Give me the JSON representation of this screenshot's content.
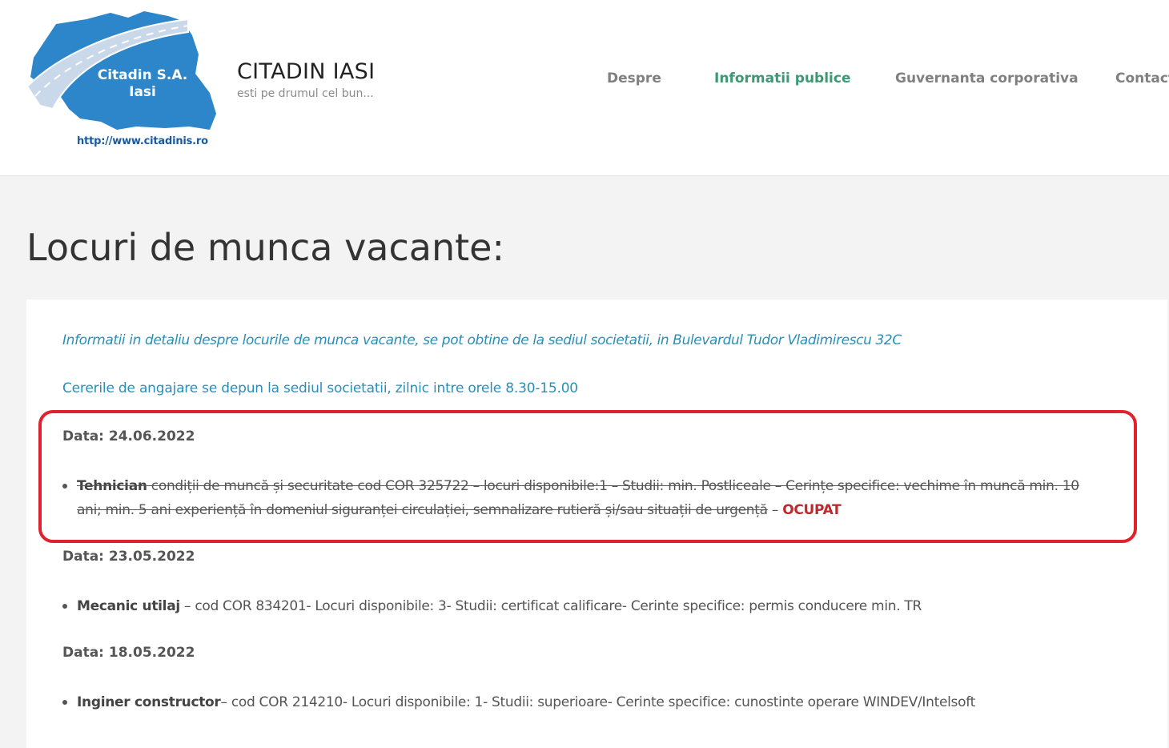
{
  "header": {
    "logo": {
      "name": "Citadin S.A.",
      "city": "Iasi",
      "url": "http://www.citadinis.ro",
      "map_color": "#2d86c9",
      "road_color": "#c9d9ea"
    },
    "site_title": "CITADIN IASI",
    "tagline": "esti pe drumul cel bun...",
    "nav": [
      {
        "label": "Despre",
        "active": false
      },
      {
        "label": "Informatii publice",
        "active": true
      },
      {
        "label": "Guvernanta corporativa",
        "active": false
      },
      {
        "label": "Contact",
        "active": false
      }
    ],
    "nav_active_color": "#3a9a72"
  },
  "page": {
    "title": "Locuri de munca vacante:"
  },
  "content": {
    "intro": "Informatii in detaliu despre locurile de munca vacante, se pot obtine de la sediul societatii, in Bulevardul Tudor Vladimirescu 32C",
    "hours": "Cererile de angajare se depun la sediul societatii, zilnic intre orele 8.30-15.00",
    "sections": [
      {
        "date": "Data: 24.06.2022",
        "jobs": [
          {
            "title": "Tehnician",
            "line1": " condiții de muncă și securitate cod COR 325722 – locuri disponibile:1 – Studii: min. Postliceale – Cerințe specifice: vechime în muncă min. 10",
            "line2": "ani; min. 5 ani experiență în domeniul siguranței circulației, semnalizare rutieră și/sau situații de urgență",
            "separator": " – ",
            "status": "OCUPAT"
          }
        ]
      },
      {
        "date": "Data: 23.05.2022",
        "jobs": [
          {
            "title": "Mecanic utilaj",
            "description": " – cod COR 834201- Locuri disponibile: 3- Studii: certificat calificare- Cerinte specifice: permis conducere min. TR"
          }
        ]
      },
      {
        "date": "Data: 18.05.2022",
        "jobs": [
          {
            "title": "Inginer constructor",
            "description": "– cod COR 214210- Locuri disponibile: 1- Studii: superioare- Cerinte specifice: cunostinte operare WINDEV/Intelsoft"
          }
        ]
      }
    ],
    "status_color": "#c0282d",
    "link_color": "#2a8fb8",
    "highlight_color": "#e0222e"
  }
}
